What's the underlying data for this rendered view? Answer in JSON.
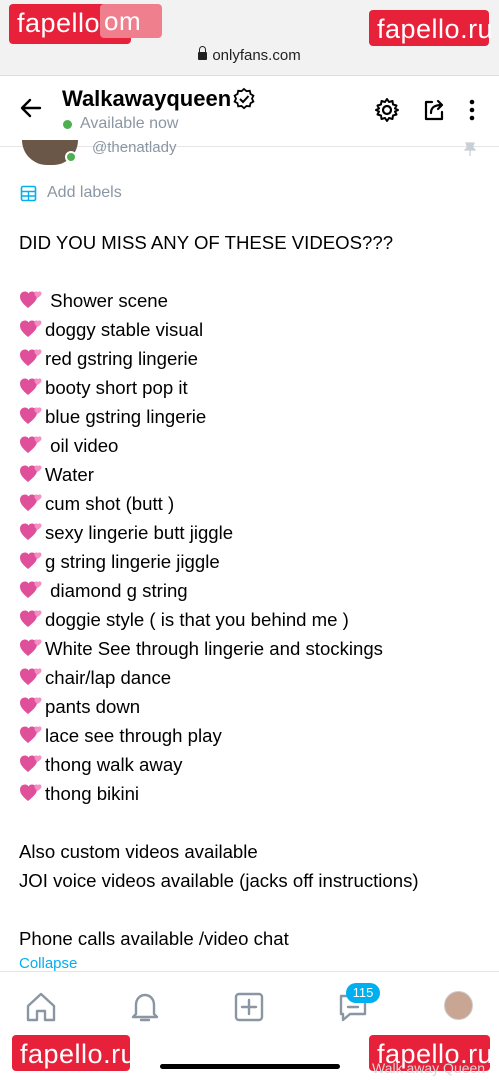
{
  "browser": {
    "url": "onlyfans.com"
  },
  "watermarks": {
    "top_left": "fapello.ru",
    "top_left_partial": "om",
    "top_right": "fapello.ru",
    "bottom_left": "fapello.ru",
    "bottom_right": "fapello.ru",
    "ghost": "Walk away Queen"
  },
  "header": {
    "back_icon": "arrow-left-icon",
    "title": "Walkawayqueen",
    "verified_icon": "verified-badge-icon",
    "status": "Available now",
    "status_color": "#4caf50",
    "settings_icon": "gear-icon",
    "share_icon": "share-icon",
    "more_icon": "more-vertical-icon"
  },
  "post_header": {
    "handle": "@thenatlady",
    "pin_icon": "pin-icon"
  },
  "labels": {
    "icon": "label-icon",
    "text": "Add labels"
  },
  "post": {
    "intro": "DID YOU MISS ANY OF THESE VIDEOS???",
    "items": [
      " Shower scene",
      "doggy stable visual",
      "red gstring lingerie",
      "booty short pop it",
      "blue gstring lingerie",
      " oil video",
      "Water",
      "cum shot (butt )",
      "sexy lingerie butt jiggle",
      "g string lingerie jiggle",
      " diamond g string",
      "doggie style ( is that you behind me )",
      "White See through lingerie and stockings",
      "chair/lap dance",
      "pants down",
      "lace see through play",
      "thong walk away",
      "thong bikini"
    ],
    "extra1": "Also custom videos available",
    "extra2": "JOI voice videos available (jacks off instructions)",
    "extra3": "Phone calls available /video chat",
    "collapse": "Collapse"
  },
  "tabbar": {
    "home_icon": "home-icon",
    "notifications_icon": "bell-icon",
    "add_icon": "plus-square-icon",
    "messages_icon": "message-icon",
    "messages_badge": "115",
    "profile_icon": "avatar"
  },
  "colors": {
    "accent": "#00aff0",
    "muted": "#8a96a3",
    "heart": "#e0509a",
    "watermark": "#e8213a"
  }
}
